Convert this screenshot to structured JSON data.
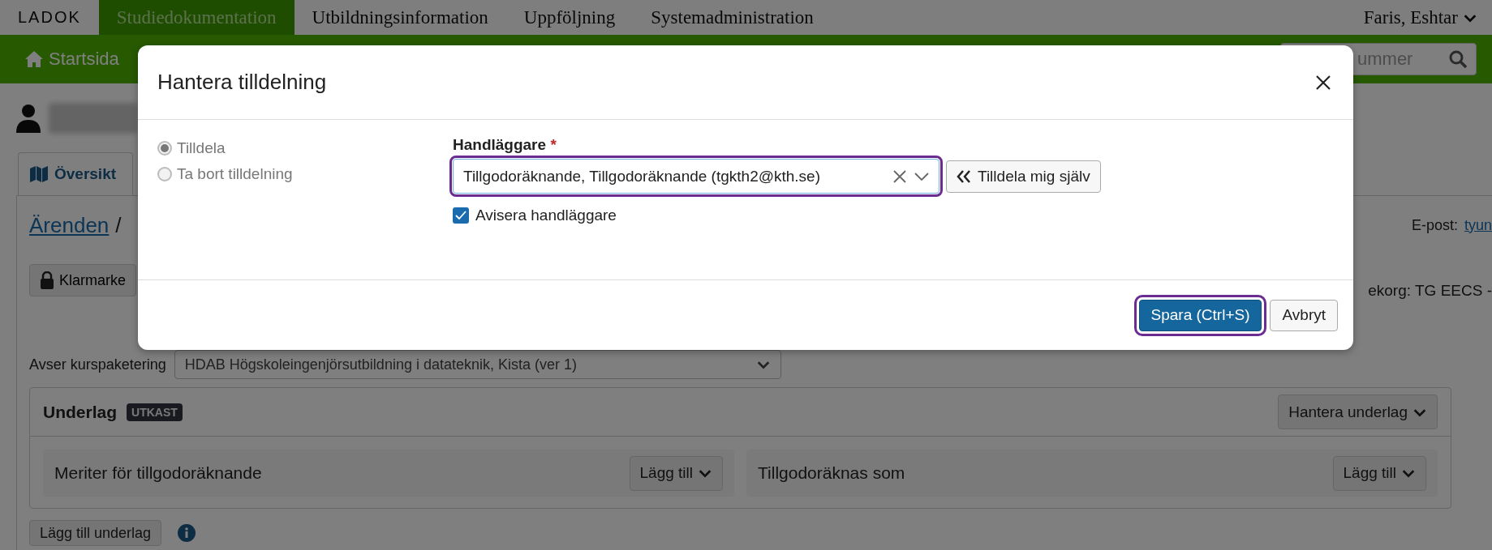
{
  "top_nav": {
    "logo": "LADOK",
    "tabs": [
      {
        "label": "Studiedokumentation",
        "selected": true
      },
      {
        "label": "Utbildningsinformation",
        "selected": false
      },
      {
        "label": "Uppföljning",
        "selected": false
      },
      {
        "label": "Systemadministration",
        "selected": false
      }
    ],
    "user": "Faris, Eshtar"
  },
  "sub_nav": {
    "home": "Startsida",
    "search": {
      "placeholder": "ummer"
    }
  },
  "page": {
    "tabs": [
      {
        "label": "Översikt",
        "selected": true
      }
    ],
    "breadcrumb": {
      "link": "Ärenden",
      "separator": "/"
    },
    "email": {
      "label": "E-post:",
      "link": "tyun"
    },
    "lock_button": "Klarmarke",
    "group_text": "ekorg: TG EECS -",
    "package": {
      "label": "Avser kurspaketering",
      "value": "HDAB Högskoleingenjörsutbildning i datateknik, Kista (ver 1)"
    },
    "underlag": {
      "title": "Underlag",
      "badge": "UTKAST",
      "menu_button": "Hantera underlag",
      "columns": [
        {
          "title": "Meriter för tillgodoräknande",
          "button": "Lägg till"
        },
        {
          "title": "Tillgodoräknas som",
          "button": "Lägg till"
        }
      ]
    },
    "add_button": "Lägg till underlag"
  },
  "dialog": {
    "title": "Hantera tilldelning",
    "options": [
      {
        "label": "Tilldela",
        "selected": true,
        "disabled": true
      },
      {
        "label": "Ta bort tilldelning",
        "selected": false,
        "disabled": true
      }
    ],
    "field": {
      "label": "Handläggare",
      "required_mark": "*",
      "value": "Tillgodoräknande, Tillgodoräknande (tgkth2@kth.se)",
      "outlined": true
    },
    "assign_self_button": "Tilldela mig själv",
    "notify": {
      "label": "Avisera handläggare",
      "checked": true
    },
    "buttons": [
      {
        "label": "Spara (Ctrl+S)",
        "kind": "primary",
        "outlined": true
      },
      {
        "label": "Avbryt",
        "kind": "secondary",
        "outlined": false
      }
    ]
  }
}
